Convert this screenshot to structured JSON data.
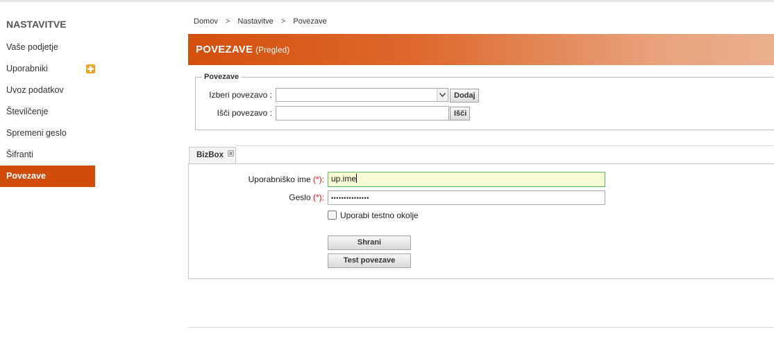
{
  "sidebar": {
    "title": "NASTAVITVE",
    "items": [
      {
        "label": "Vaše podjetje"
      },
      {
        "label": "Uporabniki"
      },
      {
        "label": "Uvoz podatkov"
      },
      {
        "label": "Številčenje"
      },
      {
        "label": "Spremeni geslo"
      },
      {
        "label": "Šifranti"
      },
      {
        "label": "Povezave"
      }
    ],
    "active_item": "Povezave",
    "accent_color": "#d14b09"
  },
  "breadcrumb": {
    "items": [
      "Domov",
      "Nastavitve",
      "Povezave"
    ],
    "separator": ">"
  },
  "header": {
    "title": "POVEZAVE",
    "subtitle": "(Pregled)"
  },
  "povezave_group": {
    "legend": "Povezave",
    "select_label": "Izberi povezavo :",
    "select_value": "",
    "add_button": "Dodaj",
    "search_label": "Išči povezavo :",
    "search_value": "",
    "search_button": "Išči"
  },
  "tab": {
    "label": "BizBox"
  },
  "form": {
    "username_label": "Uporabniško ime",
    "password_label": "Geslo",
    "required_marker": "(*):",
    "username_value": "up.ime",
    "password_value": "•••••••••••••••",
    "test_env_label": "Uporabi testno okolje",
    "test_env_checked": false,
    "save_button": "Shrani",
    "test_button": "Test povezave"
  }
}
